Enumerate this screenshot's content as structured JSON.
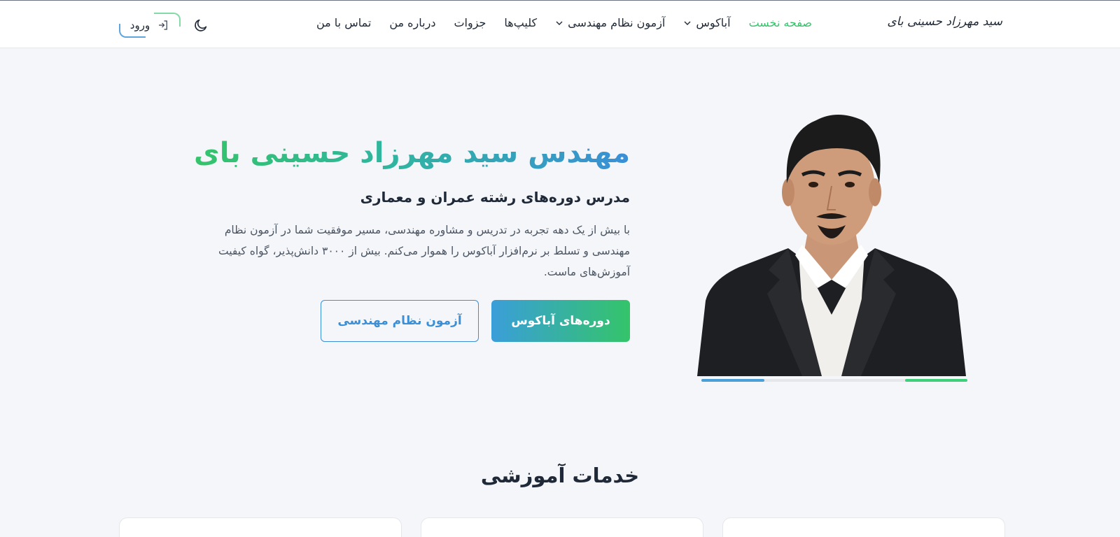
{
  "header": {
    "brand": "سید مهرزاد حسینی بای",
    "nav": [
      {
        "label": "صفحه نخست",
        "active": true,
        "dropdown": false
      },
      {
        "label": "آباکوس",
        "active": false,
        "dropdown": true
      },
      {
        "label": "آزمون نظام مهندسی",
        "active": false,
        "dropdown": true
      },
      {
        "label": "کلیپ‌ها",
        "active": false,
        "dropdown": false
      },
      {
        "label": "جزوات",
        "active": false,
        "dropdown": false
      },
      {
        "label": "درباره من",
        "active": false,
        "dropdown": false
      },
      {
        "label": "تماس با من",
        "active": false,
        "dropdown": false
      }
    ],
    "login_label": "ورود",
    "theme_icon": "moon-icon",
    "login_icon": "sign-in-icon"
  },
  "hero": {
    "title": "مهندس سید مهرزاد حسینی بای",
    "subtitle": "مدرس دوره‌های رشته عمران و معماری",
    "description": "با بیش از یک دهه تجربه در تدریس و مشاوره مهندسی، مسیر موفقیت شما در آزمون نظام مهندسی و تسلط بر نرم‌افزار آباکوس را هموار می‌کنم. بیش از ۳۰۰۰ دانش‌پذیر، گواه کیفیت آموزش‌های ماست.",
    "primary_button": "دوره‌های آباکوس",
    "secondary_button": "آزمون نظام مهندسی"
  },
  "services": {
    "title": "خدمات آموزشی"
  },
  "colors": {
    "accent_green": "#34c46a",
    "accent_blue": "#3a8fd6",
    "text_dark": "#1f2937",
    "background": "#f4f6f9"
  }
}
